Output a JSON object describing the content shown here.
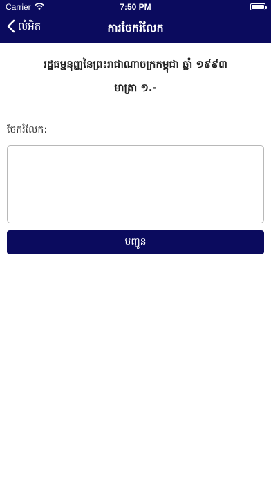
{
  "status_bar": {
    "carrier": "Carrier",
    "time": "7:50 PM",
    "battery_level": 1.0
  },
  "nav": {
    "back_label": "លំអិត",
    "title": "ការចែករំលែក"
  },
  "main": {
    "law_title": "រដ្ឋធម្មនុញ្ញនៃព្រះរាជាណាចក្រកម្ពុជា ឆ្នាំ ១៩៩៣",
    "article": "មាត្រា ១.-",
    "share_label": "ចែករំលែក:",
    "comment_value": "",
    "submit_label": "បញ្ជូន"
  },
  "colors": {
    "primary": "#0b0b5e",
    "border": "#b8b8b8"
  },
  "icons": {
    "wifi": "wifi-icon",
    "battery": "battery-icon",
    "back": "chevron-left-icon"
  }
}
